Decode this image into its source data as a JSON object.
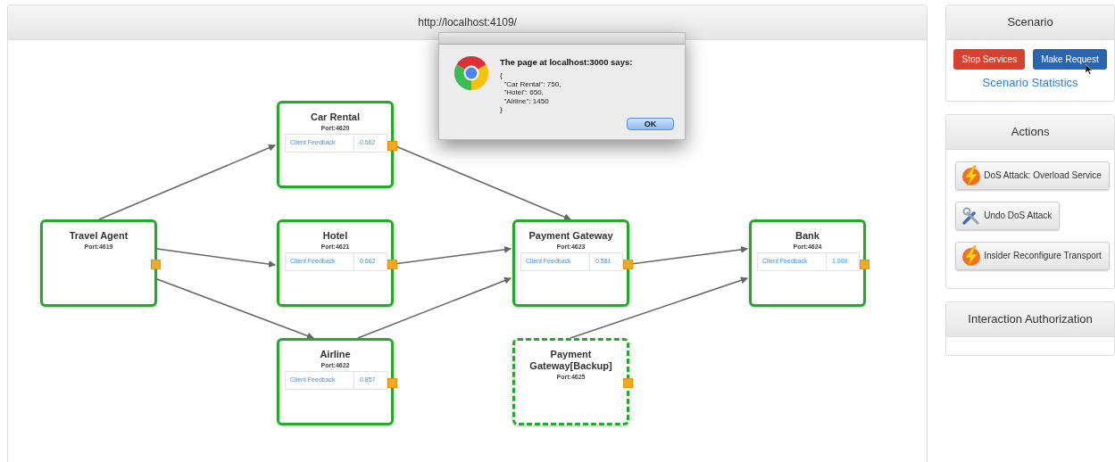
{
  "browser": {
    "url": "http://localhost:4109/"
  },
  "nodes": [
    {
      "kind": "service",
      "name": "Car Rental",
      "port": "Port:4620",
      "metric": {
        "label": "Client Feedback",
        "value": "0.662"
      }
    },
    {
      "kind": "service",
      "name": "Travel Agent",
      "port": "Port:4619"
    },
    {
      "kind": "service",
      "name": "Hotel",
      "port": "Port:4621",
      "metric": {
        "label": "Client Feedback",
        "value": "0.662"
      }
    },
    {
      "kind": "service",
      "name": "Payment Gateway",
      "port": "Port:4623",
      "metric": {
        "label": "Client Feedback",
        "value": "0.581"
      }
    },
    {
      "kind": "service",
      "name": "Bank",
      "port": "Port:4624",
      "metric": {
        "label": "Client Feedback",
        "value": "1.000"
      }
    },
    {
      "kind": "service",
      "name": "Airline",
      "port": "Port:4622",
      "metric": {
        "label": "Client Feedback",
        "value": "0.857"
      }
    },
    {
      "kind": "backup",
      "name": "Payment Gateway[Backup]",
      "port": "Port:4625"
    }
  ],
  "alert": {
    "title": "The page at localhost:3000 says:",
    "message": "{\n  \"Car Rental\": 750,\n  \"Hotel\": 650,\n  \"Airline\": 1450\n}",
    "button": "OK"
  },
  "sidebar": {
    "panels": [
      {
        "title": "Scenario",
        "buttons": [
          {
            "label": "Stop Services",
            "kind": "danger"
          },
          {
            "label": "Make Request",
            "kind": "primary"
          }
        ],
        "link": "Scenario Statistics"
      },
      {
        "title": "Actions",
        "actions": [
          {
            "label": "DoS Attack: Overload Service",
            "kind": "attack"
          },
          {
            "label": "Undo DoS Attack",
            "kind": "repair"
          },
          {
            "label": "Insider Reconfigure Transport",
            "kind": "attack"
          }
        ]
      },
      {
        "title": "Interaction Authorization"
      }
    ]
  }
}
